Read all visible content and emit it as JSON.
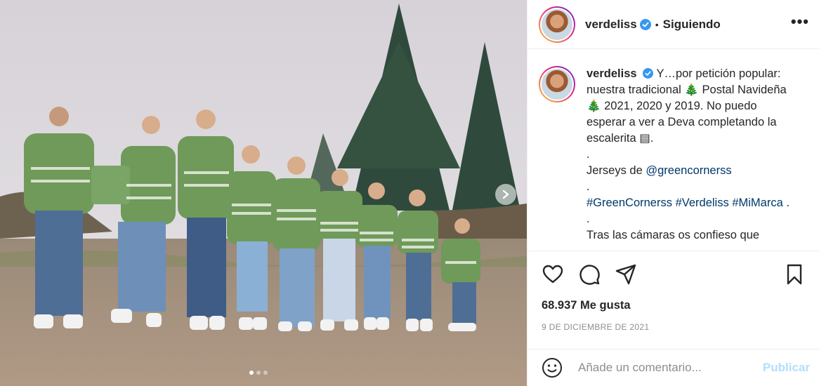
{
  "post": {
    "username": "verdeliss",
    "separator": "•",
    "follow_status": "Siguiendo",
    "more_label": "•••"
  },
  "caption": {
    "username": "verdeliss",
    "lines": [
      "Y…por petición popular:",
      "nuestra tradicional 🎄 Postal Navideña",
      "🎄 2021, 2020 y 2019. No puedo",
      "esperar a ver a Deva completando la",
      "escalerita ▤.",
      ".",
      "Jerseys de ",
      ".",
      ".",
      "Tras las cámaras os confieso que"
    ],
    "mention": "@greencornerss",
    "hashtags": [
      "#GreenCornerss",
      "#Verdeliss",
      "#MiMarca"
    ],
    "hashtag_suffix": " ."
  },
  "stats": {
    "likes": "68.937 Me gusta",
    "date": "9 DE DICIEMBRE DE 2021"
  },
  "comment": {
    "placeholder": "Añade un comentario...",
    "publish_label": "Publicar"
  },
  "carousel": {
    "total_slides": 3,
    "active_slide": 1
  },
  "icons": {
    "verified": "verified-badge-icon",
    "like": "heart-icon",
    "comment": "comment-icon",
    "share": "share-icon",
    "save": "bookmark-icon",
    "emoji": "emoji-icon",
    "next": "chevron-right-icon"
  },
  "colors": {
    "verified_blue": "#3897f0",
    "link_blue": "#00376b",
    "publish_disabled": "#b2dffc",
    "sweater_green": "#6f9a5a"
  }
}
